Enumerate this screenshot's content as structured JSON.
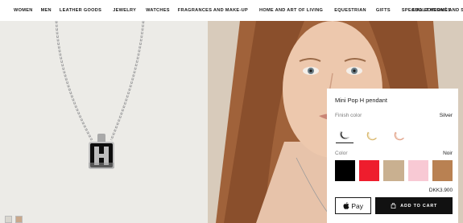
{
  "nav": {
    "items": [
      "WOMEN",
      "MEN",
      "LEATHER GOODS",
      "JEWELRY",
      "WATCHES",
      "FRAGRANCES AND MAKE-UP",
      "HOME AND ART OF LIVING",
      "EQUESTRIAN",
      "GIFTS",
      "SPECIAL EDITIONS AND SERVICES"
    ],
    "about": "ABOUT HERMÈS"
  },
  "product": {
    "title": "Mini Pop H pendant",
    "finish_label": "Finish color",
    "finish_value": "Silver",
    "color_label": "Color",
    "color_value": "Noir",
    "price": "DKK3.900",
    "pay_label": "Pay",
    "cart_label": "ADD TO CART",
    "finishes": [
      {
        "name": "silver",
        "colors": [
          "#c8c8c8",
          "#111111"
        ],
        "selected": true
      },
      {
        "name": "gold",
        "colors": [
          "#d9b970",
          "#f1e3c2"
        ],
        "selected": false
      },
      {
        "name": "rose-gold",
        "colors": [
          "#e2a48b",
          "#f3d6c7"
        ],
        "selected": false
      }
    ],
    "colors": [
      "#000000",
      "#ee1d2d",
      "#c9b090",
      "#f8c9d4",
      "#b98152"
    ]
  }
}
